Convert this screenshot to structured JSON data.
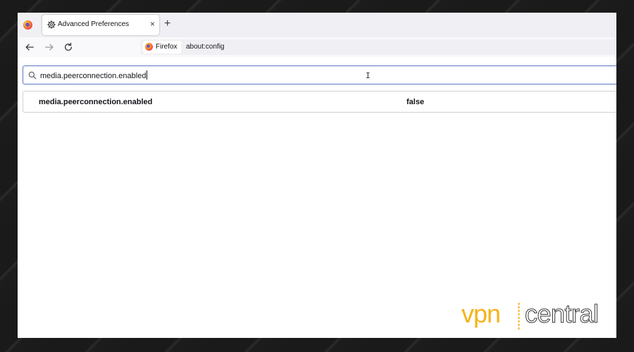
{
  "browser": {
    "tab": {
      "title": "Advanced Preferences",
      "close_glyph": "×"
    },
    "new_tab_glyph": "+",
    "nav": {
      "back_icon": "arrow-left-icon",
      "forward_icon": "arrow-right-icon",
      "reload_icon": "reload-icon"
    },
    "identity_label": "Firefox",
    "url": "about:config"
  },
  "config": {
    "search_value": "media.peerconnection.enabled",
    "rows": [
      {
        "name": "media.peerconnection.enabled",
        "value": "false"
      }
    ]
  },
  "watermark": {
    "part1": "vpn",
    "part2": "central"
  },
  "colors": {
    "accent_focus": "#5b74c6",
    "watermark_orange": "#f5b21a",
    "tabstrip": "#f0f0f4"
  }
}
